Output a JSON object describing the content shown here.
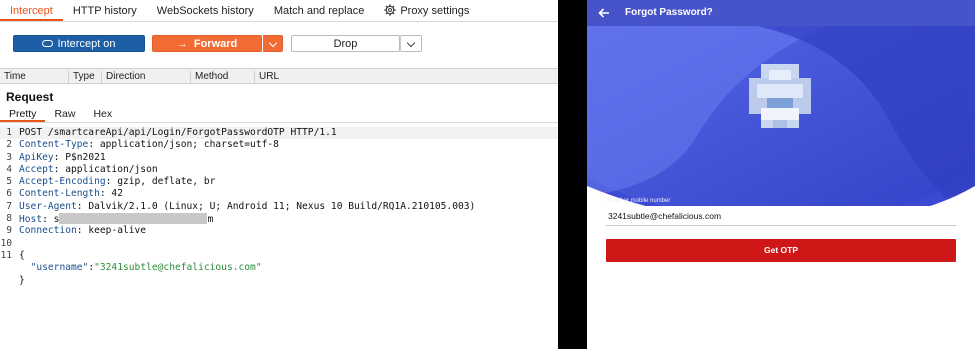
{
  "burp": {
    "tabs": [
      "Intercept",
      "HTTP history",
      "WebSockets history",
      "Match and replace",
      "Proxy settings"
    ],
    "intercept_label": "Intercept on",
    "forward_label": "Forward",
    "drop_label": "Drop",
    "columns": [
      "Time",
      "Type",
      "Direction",
      "Method",
      "URL"
    ],
    "request_title": "Request",
    "subtabs": [
      "Pretty",
      "Raw",
      "Hex"
    ],
    "lines": [
      {
        "n": "1",
        "text": "POST /smartcareApi/api/Login/ForgotPasswordOTP HTTP/1.1"
      },
      {
        "n": "2",
        "key": "Content-Type",
        "val": " application/json; charset=utf-8"
      },
      {
        "n": "3",
        "key": "ApiKey",
        "val": " P$n2021"
      },
      {
        "n": "4",
        "key": "Accept",
        "val": " application/json"
      },
      {
        "n": "5",
        "key": "Accept-Encoding",
        "val": " gzip, deflate, br"
      },
      {
        "n": "6",
        "key": "Content-Length",
        "val": " 42"
      },
      {
        "n": "7",
        "key": "User-Agent",
        "val": " Dalvik/2.1.0 (Linux; U; Android 11; Nexus 10 Build/RQ1A.210105.003)"
      },
      {
        "n": "8",
        "key": "Host",
        "val_pre": " s",
        "val_post": "m"
      },
      {
        "n": "9",
        "key": "Connection",
        "val": " keep-alive"
      },
      {
        "n": "10",
        "text": ""
      },
      {
        "n": "11",
        "text": "{"
      },
      {
        "n": "",
        "json_key": "\"username\"",
        "json_val": "\"3241subtle@chefalicious.com\""
      },
      {
        "n": "",
        "text": "}"
      }
    ]
  },
  "phone": {
    "title": "Forgot Password?",
    "field_label": "Email or mobile number",
    "field_value": "3241subtle@chefalicious.com",
    "otp_label": "Get OTP",
    "colors": {
      "appbar": "#4753c9",
      "button": "#cf1717",
      "hero": "#3f51d4"
    }
  }
}
